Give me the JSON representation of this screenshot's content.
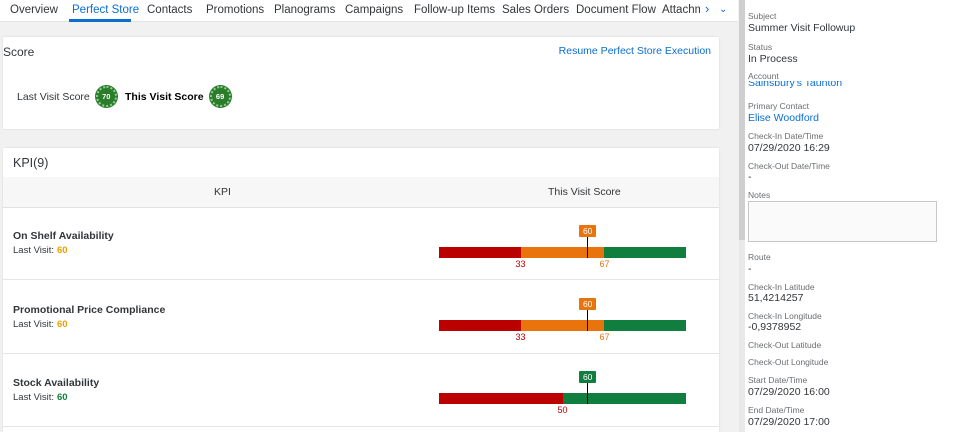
{
  "tabs": [
    {
      "label": "Overview"
    },
    {
      "label": "Perfect Store"
    },
    {
      "label": "Contacts"
    },
    {
      "label": "Promotions"
    },
    {
      "label": "Planograms"
    },
    {
      "label": "Campaigns"
    },
    {
      "label": "Follow-up Items"
    },
    {
      "label": "Sales Orders"
    },
    {
      "label": "Document Flow"
    },
    {
      "label": "Attachm"
    }
  ],
  "active_tab": "Perfect Store",
  "score": {
    "title": "Score",
    "resume_link": "Resume Perfect Store Execution",
    "last_visit_label": "Last Visit Score",
    "last_visit_value": "70",
    "this_visit_label": "This Visit Score",
    "this_visit_value": "69"
  },
  "kpi": {
    "title": "KPI(9)",
    "col_kpi": "KPI",
    "col_score": "This Visit Score",
    "last_visit_prefix": "Last Visit:",
    "rows": [
      {
        "name": "On Shelf Availability",
        "last_visit": "60",
        "current": 60,
        "current_label": "60",
        "thresholds": [
          33,
          67
        ],
        "threshold_labels": [
          "33",
          "67"
        ],
        "marker_color": "#e9730c",
        "last_color": "#e9a100"
      },
      {
        "name": "Promotional Price Compliance",
        "last_visit": "60",
        "current": 60,
        "current_label": "60",
        "thresholds": [
          33,
          67
        ],
        "threshold_labels": [
          "33",
          "67"
        ],
        "marker_color": "#e9730c",
        "last_color": "#e9a100"
      },
      {
        "name": "Stock Availability",
        "last_visit": "60",
        "current": 60,
        "current_label": "60",
        "thresholds": [
          50
        ],
        "threshold_labels": [
          "50"
        ],
        "marker_color": "#107e3e",
        "last_color": "#107e3e"
      }
    ]
  },
  "colors": {
    "red": "#bb0000",
    "orange": "#e9730c",
    "green": "#107e3e",
    "link": "#0a6ed1"
  },
  "details": {
    "subject_label": "Subject",
    "subject": "Summer Visit Followup",
    "status_label": "Status",
    "status": "In Process",
    "account_label": "Account",
    "account": "Sainsbury's Taunton",
    "primary_contact_label": "Primary Contact",
    "primary_contact": "Elise Woodford",
    "checkin_label": "Check-In Date/Time",
    "checkin": "07/29/2020 16:29",
    "checkout_label": "Check-Out Date/Time",
    "checkout": "-",
    "notes_label": "Notes",
    "route_label": "Route",
    "route": "-",
    "checkin_lat_label": "Check-In Latitude",
    "checkin_lat": "51,4214257",
    "checkin_lon_label": "Check-In Longitude",
    "checkin_lon": "-0,9378952",
    "checkout_lat_label": "Check-Out Latitude",
    "checkout_lon_label": "Check-Out Longitude",
    "start_label": "Start Date/Time",
    "start": "07/29/2020 16:00",
    "end_label": "End Date/Time",
    "end": "07/29/2020 17:00"
  }
}
